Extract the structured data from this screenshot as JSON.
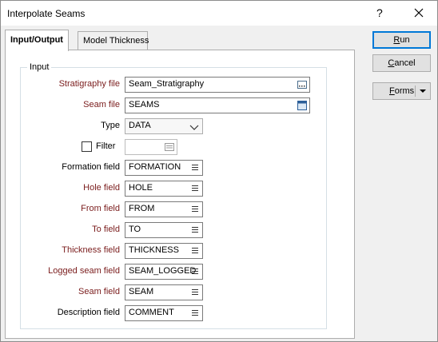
{
  "window": {
    "title": "Interpolate Seams",
    "help": "?"
  },
  "tabs": [
    {
      "label": "Input/Output",
      "active": true
    },
    {
      "label": "Model Thickness",
      "active": false
    }
  ],
  "input_group": {
    "title": "Input"
  },
  "fields": {
    "stratigraphy_file": {
      "label": "Stratigraphy file",
      "value": "Seam_Stratigraphy",
      "icon": "browse-icon"
    },
    "seam_file": {
      "label": "Seam file",
      "value": "SEAMS",
      "icon": "file-icon"
    },
    "type": {
      "label": "Type",
      "value": "DATA",
      "icon": "chevron-down-icon"
    },
    "filter": {
      "label": "Filter",
      "checked": false,
      "value": "",
      "icon": "list-icon"
    },
    "formation_field": {
      "label": "Formation field",
      "value": "FORMATION"
    },
    "hole_field": {
      "label": "Hole field",
      "value": "HOLE"
    },
    "from_field": {
      "label": "From field",
      "value": "FROM"
    },
    "to_field": {
      "label": "To field",
      "value": "TO"
    },
    "thickness_field": {
      "label": "Thickness field",
      "value": "THICKNESS"
    },
    "logged_seam_field": {
      "label": "Logged seam field",
      "value": "SEAM_LOGGED"
    },
    "seam_field": {
      "label": "Seam field",
      "value": "SEAM"
    },
    "description_field": {
      "label": "Description field",
      "value": "COMMENT"
    }
  },
  "buttons": {
    "run": {
      "label": "Run",
      "mnemonic": "R",
      "rest": "un"
    },
    "cancel": {
      "label": "Cancel",
      "mnemonic": "C",
      "rest": "ancel"
    },
    "forms": {
      "label": "Forms",
      "mnemonic": "F",
      "rest": "orms"
    }
  },
  "colors": {
    "required_label": "#7a1c1c",
    "default_button_border": "#0078d7"
  }
}
